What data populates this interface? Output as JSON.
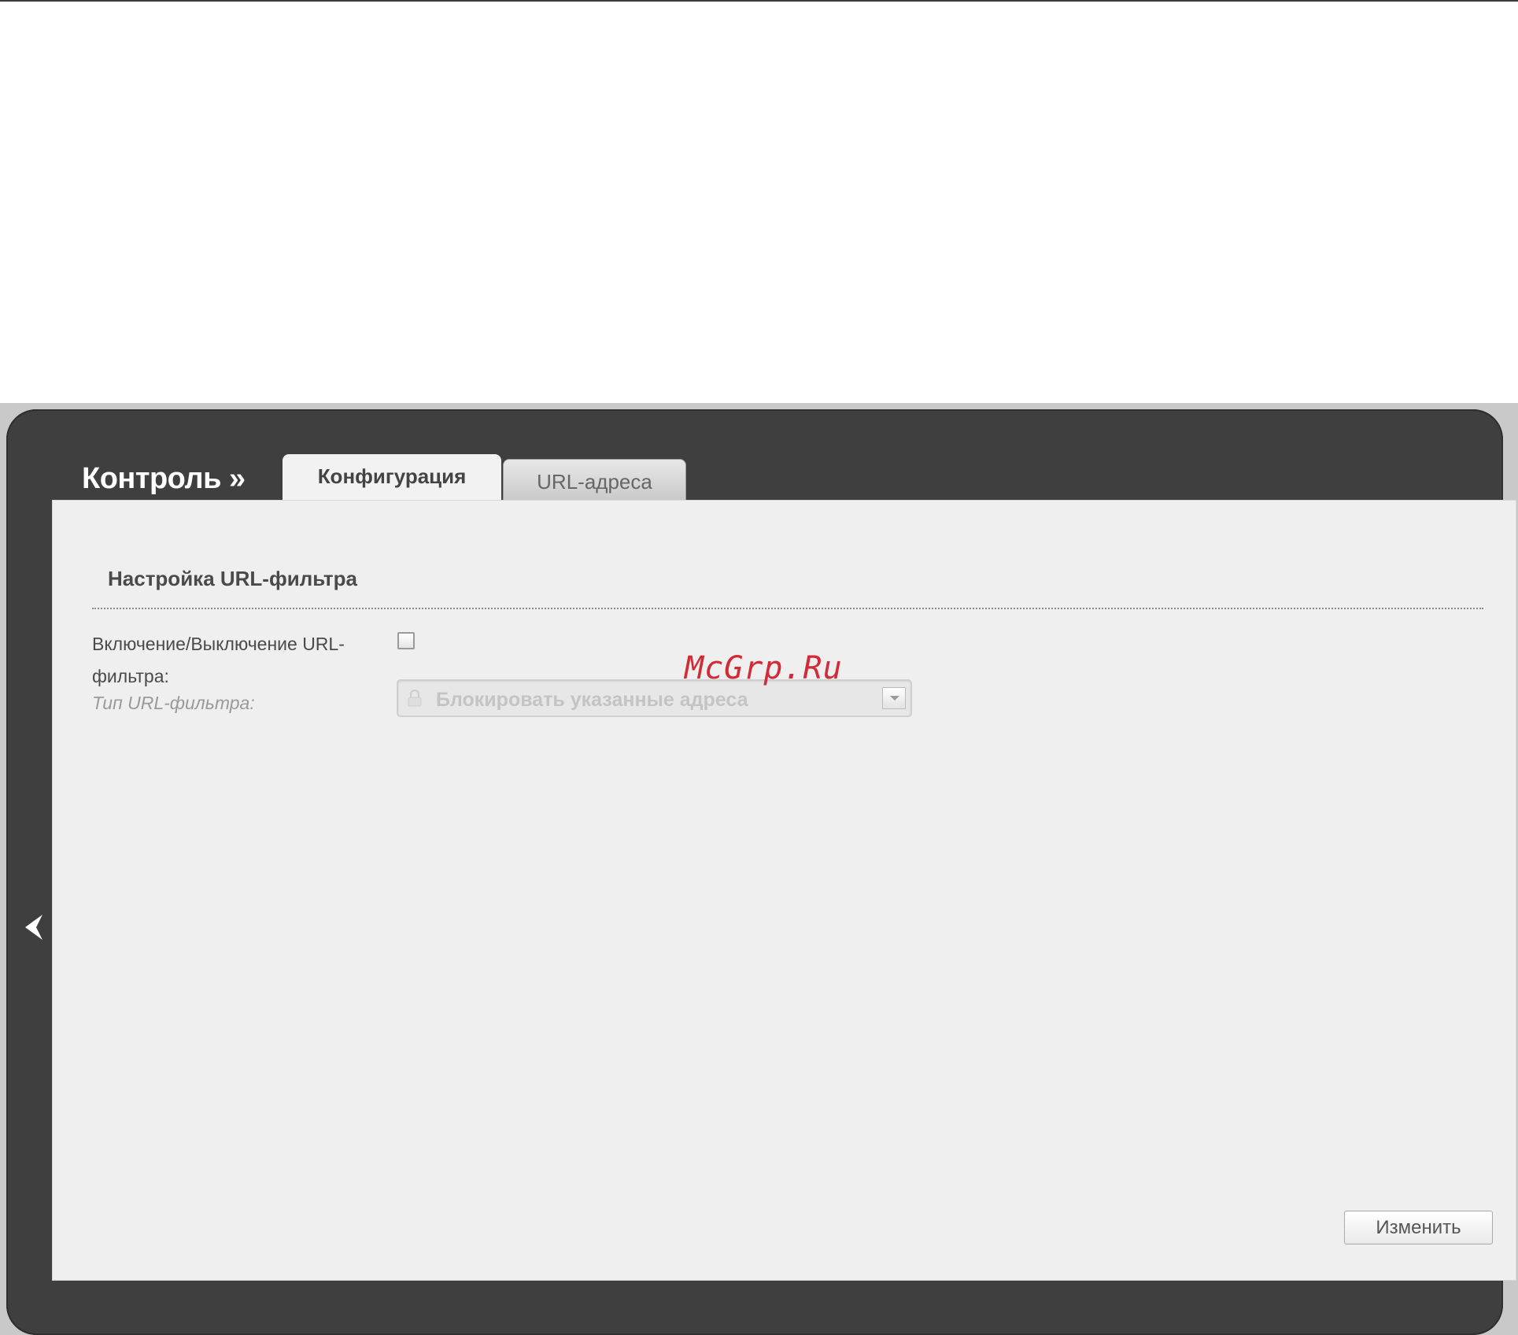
{
  "watermark": "McGrp.Ru",
  "header": {
    "section_title": "Контроль »",
    "tabs": [
      {
        "label": "Конфигурация",
        "active": true
      },
      {
        "label": "URL-адреса",
        "active": false
      }
    ]
  },
  "panel": {
    "heading": "Настройка URL-фильтра",
    "fields": {
      "enable_label": "Включение/Выключение URL-фильтра:",
      "enable_checked": false,
      "type_label": "Тип URL-фильтра:",
      "type_value": "Блокировать указанные адреса"
    },
    "save_label": "Изменить"
  },
  "icons": {
    "back": "chevron-left-icon",
    "dropdown": "chevron-down-icon",
    "lock": "lock-icon"
  },
  "colors": {
    "frame": "#3f3f3f",
    "panel": "#efefef",
    "watermark": "#d22a36"
  }
}
